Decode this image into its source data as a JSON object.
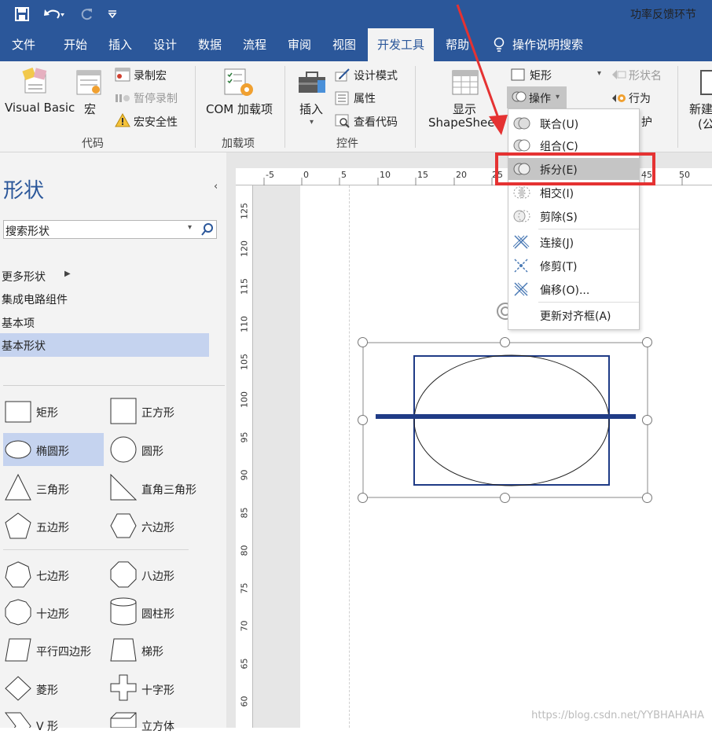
{
  "title_bar": {
    "document_title": "功率反馈环节",
    "save_icon": "save-icon",
    "undo_icon": "undo-icon",
    "redo_icon": "redo-icon",
    "customize_icon": "customize-icon"
  },
  "tabs": [
    {
      "label": "文件",
      "active": false
    },
    {
      "label": "开始",
      "active": false
    },
    {
      "label": "插入",
      "active": false
    },
    {
      "label": "设计",
      "active": false
    },
    {
      "label": "数据",
      "active": false
    },
    {
      "label": "流程",
      "active": false
    },
    {
      "label": "审阅",
      "active": false
    },
    {
      "label": "视图",
      "active": false
    },
    {
      "label": "开发工具",
      "active": true
    },
    {
      "label": "帮助",
      "active": false
    },
    {
      "label": "操作说明搜索",
      "active": false
    }
  ],
  "ribbon": {
    "code_group": {
      "label": "代码",
      "visual_basic": "Visual Basic",
      "macros": "宏",
      "record_macro": "录制宏",
      "pause_recording": "暂停录制",
      "macro_security": "宏安全性"
    },
    "addins_group": {
      "label": "加载项",
      "com_addins": "COM 加载项"
    },
    "controls_group": {
      "label": "控件",
      "insert": "插入",
      "design_mode": "设计模式",
      "properties": "属性",
      "view_code": "查看代码"
    },
    "show_shapesheet": {
      "line1": "显示",
      "line2": "ShapeSheet"
    },
    "shape_design": {
      "rectangle": "矩形",
      "operations": "操作",
      "shape_name": "形状名",
      "behavior": "行为",
      "protect": "护"
    },
    "new_stencil": {
      "line1": "新建",
      "line2": "(公"
    }
  },
  "shapes_panel": {
    "title": "形状",
    "search_placeholder": "搜索形状",
    "more_shapes": "更多形状",
    "stencils": [
      "集成电路组件",
      "基本项",
      "基本形状"
    ],
    "selected_stencil": "基本形状",
    "shapes": [
      {
        "left": "矩形",
        "right": "正方形"
      },
      {
        "left": "椭圆形",
        "right": "圆形"
      },
      {
        "left": "三角形",
        "right": "直角三角形"
      },
      {
        "left": "五边形",
        "right": "六边形"
      },
      {
        "left": "七边形",
        "right": "八边形"
      },
      {
        "left": "十边形",
        "right": "圆柱形"
      },
      {
        "left": "平行四边形",
        "right": "梯形"
      },
      {
        "left": "菱形",
        "right": "十字形"
      },
      {
        "left": "V 形",
        "right": "立方体"
      }
    ],
    "selected_shape": "椭圆形"
  },
  "ruler": {
    "horizontal": [
      "-5",
      "0",
      "5",
      "10",
      "15",
      "20",
      "25",
      "45",
      "50"
    ],
    "vertical": [
      "125",
      "120",
      "115",
      "110",
      "105",
      "100",
      "95",
      "90",
      "85",
      "80",
      "75",
      "70",
      "65",
      "60"
    ]
  },
  "operations_menu": {
    "items": [
      {
        "label": "联合(U)",
        "icon": "union-icon"
      },
      {
        "label": "组合(C)",
        "icon": "combine-icon"
      },
      {
        "label": "拆分(E)",
        "icon": "fragment-icon",
        "highlighted": true
      },
      {
        "label": "相交(I)",
        "icon": "intersect-icon"
      },
      {
        "label": "剪除(S)",
        "icon": "subtract-icon"
      },
      {
        "label": "连接(J)",
        "icon": "join-icon"
      },
      {
        "label": "修剪(T)",
        "icon": "trim-icon"
      },
      {
        "label": "偏移(O)...",
        "icon": "offset-icon"
      },
      {
        "label": "更新对齐框(A)",
        "icon": ""
      }
    ]
  },
  "watermark": "https://blog.csdn.net/YYBHAHAHA",
  "colors": {
    "title_bar": "#2b579a",
    "ribbon": "#f3f3f3",
    "highlight_box": "#e53232",
    "selected_stencil": "#c5d3ef",
    "shape_line": "#1f3b86"
  }
}
